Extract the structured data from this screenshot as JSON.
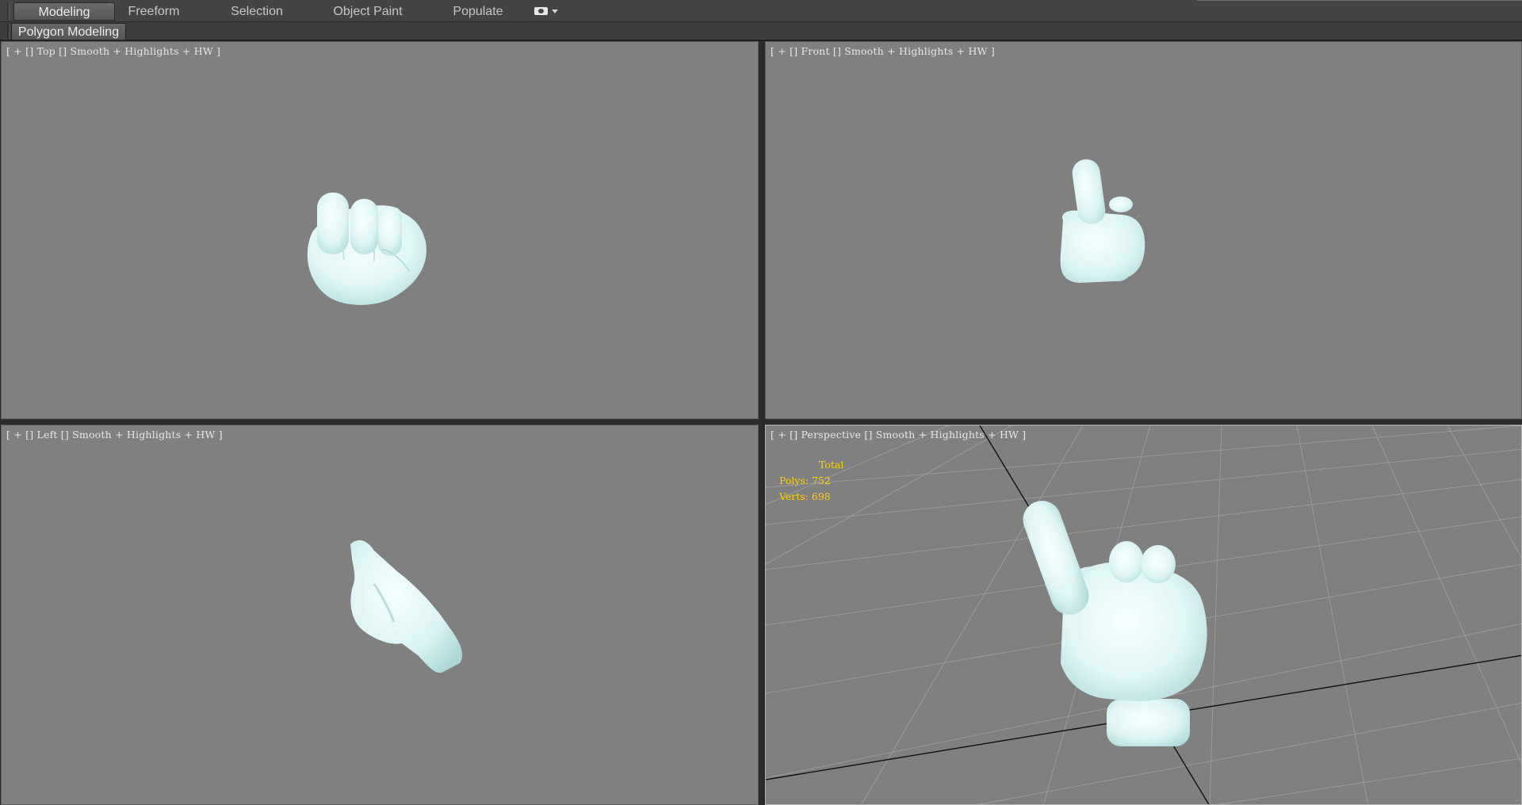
{
  "ribbon": {
    "tabs": [
      {
        "label": "Modeling",
        "active": true
      },
      {
        "label": "Freeform",
        "active": false
      },
      {
        "label": "Selection",
        "active": false
      },
      {
        "label": "Object Paint",
        "active": false
      },
      {
        "label": "Populate",
        "active": false
      }
    ],
    "menu_icon": "camera-icon",
    "panel_tab": "Polygon Modeling"
  },
  "viewports": {
    "top": {
      "plus": "+",
      "name": "Top",
      "shading": "Smooth",
      "highlights": "Highlights",
      "mode": "HW"
    },
    "front": {
      "plus": "+",
      "name": "Front",
      "shading": "Smooth",
      "highlights": "Highlights",
      "mode": "HW"
    },
    "left": {
      "plus": "+",
      "name": "Left",
      "shading": "Smooth",
      "highlights": "Highlights",
      "mode": "HW"
    },
    "perspective": {
      "plus": "+",
      "name": "Perspective",
      "shading": "Smooth",
      "highlights": "Highlights",
      "mode": "HW"
    }
  },
  "stats": {
    "header": "Total",
    "polys_label": "Polys:",
    "polys_value": "752",
    "verts_label": "Verts:",
    "verts_value": "698"
  },
  "colors": {
    "viewport_bg": "#808080",
    "model": "#e4f7f7",
    "model_shade": "#a9d6d6",
    "stats_text": "#ffd200",
    "ribbon_bg": "#444444"
  }
}
